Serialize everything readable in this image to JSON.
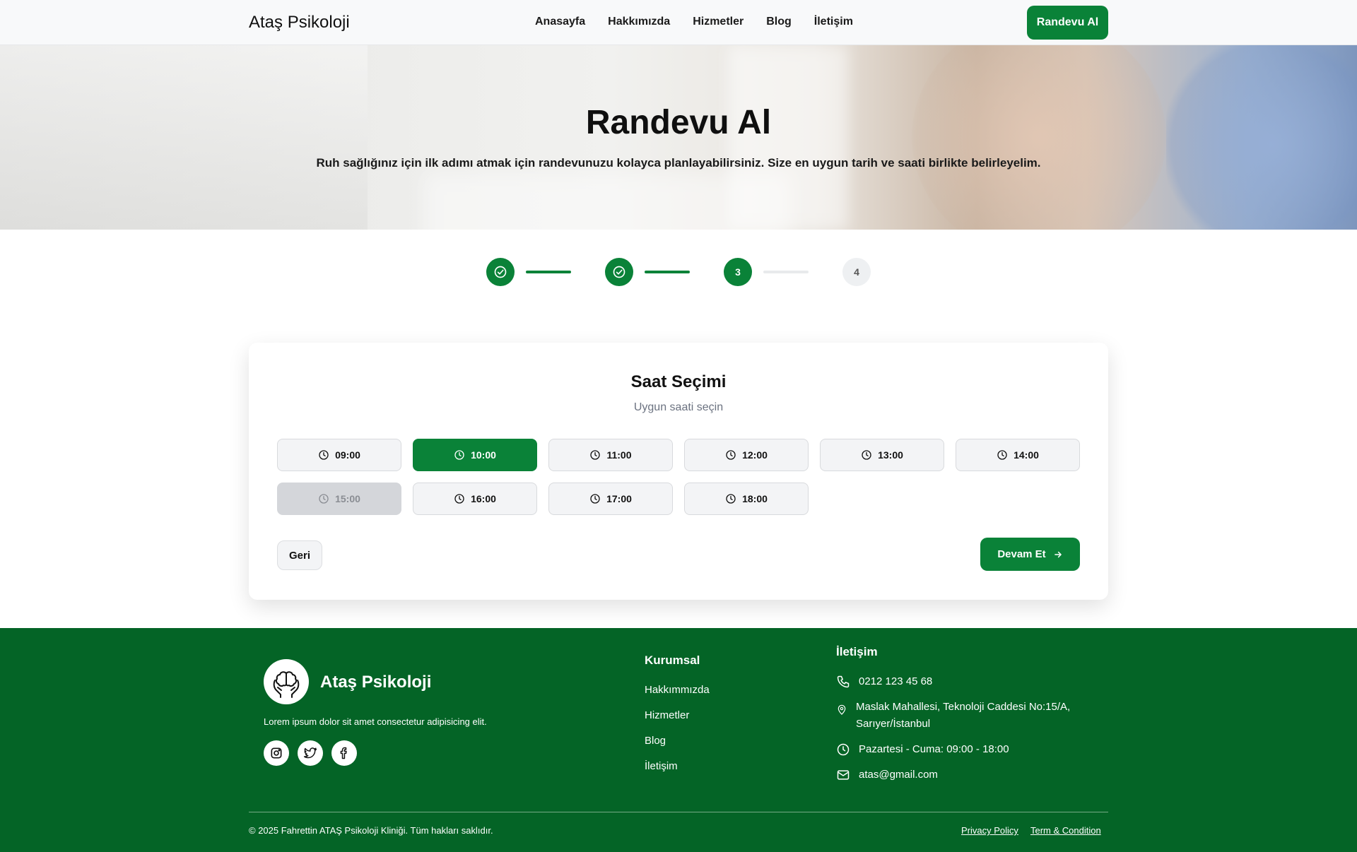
{
  "header": {
    "brand": "Ataş Psikoloji",
    "nav": [
      "Anasayfa",
      "Hakkımızda",
      "Hizmetler",
      "Blog",
      "İletişim"
    ],
    "cta": "Randevu Al"
  },
  "hero": {
    "title": "Randevu Al",
    "subtitle": "Ruh sağlığınız için ilk adımı atmak için randevunuzu kolayca planlayabilirsiniz. Size en uygun tarih ve saati birlikte belirleyelim."
  },
  "stepper": {
    "steps": [
      {
        "label": "",
        "state": "done",
        "icon": "check-circle-icon"
      },
      {
        "label": "",
        "state": "done",
        "icon": "check-circle-icon"
      },
      {
        "label": "3",
        "state": "active"
      },
      {
        "label": "4",
        "state": "pending"
      }
    ]
  },
  "time_selection": {
    "title": "Saat Seçimi",
    "subtitle": "Uygun saati seçin",
    "slots": [
      {
        "time": "09:00",
        "state": "available"
      },
      {
        "time": "10:00",
        "state": "selected"
      },
      {
        "time": "11:00",
        "state": "available"
      },
      {
        "time": "12:00",
        "state": "available"
      },
      {
        "time": "13:00",
        "state": "available"
      },
      {
        "time": "14:00",
        "state": "available"
      },
      {
        "time": "15:00",
        "state": "disabled"
      },
      {
        "time": "16:00",
        "state": "available"
      },
      {
        "time": "17:00",
        "state": "available"
      },
      {
        "time": "18:00",
        "state": "available"
      }
    ],
    "back_label": "Geri",
    "next_label": "Devam Et"
  },
  "footer": {
    "brand": "Ataş Psikoloji",
    "description": "Lorem ipsum dolor sit amet consectetur adipisicing elit.",
    "social": [
      "instagram-icon",
      "twitter-icon",
      "facebook-icon"
    ],
    "corporate_title": "Kurumsal",
    "corporate_links": [
      "Hakkımmızda",
      "Hizmetler",
      "Blog",
      "İletişim"
    ],
    "contact_title": "İletişim",
    "phone": "0212 123 45 68",
    "address_line1": "Maslak Mahallesi, Teknoloji Caddesi No:15/A,",
    "address_line2": "Sarıyer/İstanbul",
    "hours": "Pazartesi - Cuma: 09:00 - 18:00",
    "email": "atas@gmail.com",
    "copyright": "© 2025 Fahrettin ATAŞ Psikoloji Kliniği. Tüm hakları saklıdır.",
    "privacy": "Privacy Policy",
    "terms": "Term & Condition"
  },
  "colors": {
    "primary_green": "#0a8238",
    "footer_green": "#046426"
  }
}
